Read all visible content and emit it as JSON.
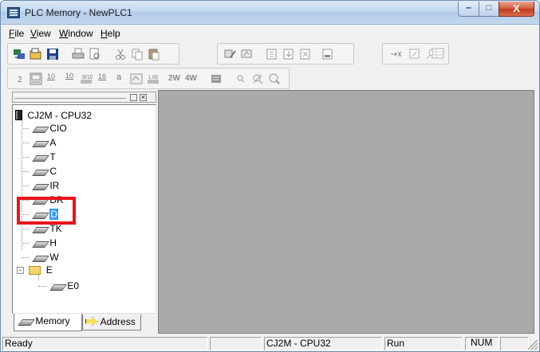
{
  "window": {
    "title": "PLC Memory - NewPLC1"
  },
  "window_controls": {
    "minimize": "–",
    "maximize": "□",
    "close": "X"
  },
  "menu": [
    {
      "underline": "F",
      "rest": "ile"
    },
    {
      "underline": "V",
      "rest": "iew"
    },
    {
      "underline": "W",
      "rest": "indow"
    },
    {
      "underline": "H",
      "rest": "elp"
    }
  ],
  "toolbar2_text": {
    "t1": "10",
    "t2": "10",
    "t3": "16",
    "t4": "a",
    "t5": "2W",
    "t6": "4W"
  },
  "tree": {
    "root": "CJ2M - CPU32",
    "items": [
      "CIO",
      "A",
      "T",
      "C",
      "IR",
      "DR",
      "D",
      "TK",
      "H",
      "W"
    ],
    "folder": "E",
    "folder_children": [
      "E0"
    ],
    "selected": "D"
  },
  "tabs": {
    "memory": "Memory",
    "address": "Address"
  },
  "status": {
    "ready": "Ready",
    "device": "CJ2M - CPU32",
    "mode": "Run",
    "num": "NUM"
  },
  "colors": {
    "highlight": "#e8141b",
    "selection": "#3399ff",
    "mdi_background": "#a9a9a9"
  }
}
